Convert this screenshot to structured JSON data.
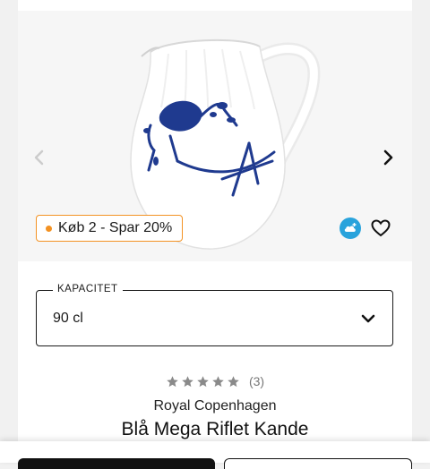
{
  "gallery": {
    "image_icon": "porcelain-jug-image",
    "prev_icon": "chevron-left-icon",
    "next_icon": "chevron-right-icon",
    "promo_label": "Køb 2 - Spar 20%",
    "promo_color": "#f39223",
    "cloud_badge_icon": "cloud-plus-icon",
    "cloud_badge_color": "#29a3dc",
    "wishlist_icon": "heart-icon"
  },
  "variant": {
    "label": "KAPACITET",
    "value": "90 cl",
    "chevron_icon": "chevron-down-icon"
  },
  "rating": {
    "stars": 0,
    "max": 5,
    "count": "(3)"
  },
  "product": {
    "brand": "Royal Copenhagen",
    "title": "Blå Mega Riflet Kande"
  },
  "colors": {
    "pattern_blue": "#1f3a8f",
    "star_gray": "#8a8a8a"
  }
}
